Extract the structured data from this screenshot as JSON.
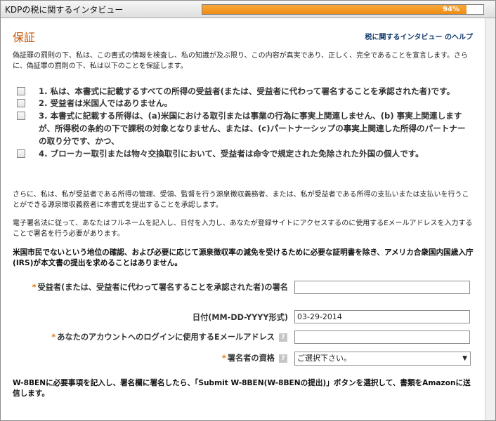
{
  "window": {
    "title": "KDPの税に関するインタビュー",
    "progress": {
      "value": 94,
      "label": "94%"
    }
  },
  "page": {
    "heading": "保証",
    "help_link": "税に関するインタビュー のヘルプ",
    "intro": "偽証罪の罰則の下、私は、この書式の情報を検査し、私の知識が及ぶ限り、この内容が真実であり、正しく、完全であることを宣言します。さらに、偽証罪の罰則の下、私は以下のことを保証します。",
    "checkboxes": [
      {
        "number": "1.",
        "text": "私は、本書式に記載するすべての所得の受益者(または、受益者に代わって署名することを承認された者)です。"
      },
      {
        "number": "2.",
        "text": "受益者は米国人ではありません。"
      },
      {
        "number": "3.",
        "text": "本書式に記載する所得は、(a)米国における取引または事業の行為に事実上関連しません、(b) 事実上関連しますが、所得税の条約の下で課税の対象となりません、または、(c)パートナーシップの事実上関連した所得のパートナーの取り分です、かつ、"
      },
      {
        "number": "4.",
        "text": "ブローカー取引または物々交換取引において、受益者は命令で規定された免除された外国の個人です。"
      }
    ],
    "para_withholding": "さらに、私は、私が受益者である所得の管理、受領、監督を行う源泉徴収義務者、または、私が受益者である所得の支払いまたは支払いを行うことができる源泉徴収義務者に本書式を提出することを承認します。",
    "para_signature": "電子署名法に従って、あなたはフルネームを記入し、日付を入力し、あなたが登録サイトにアクセスするのに使用するEメールアドレスを入力することで署名を行う必要があります。",
    "bold_notice": "米国市民でないという地位の確認、および必要に応じて源泉徴収率の減免を受けるために必要な証明書を除き、アメリカ合衆国内国歳入庁(IRS)が本文書の提出を求めることはありません。",
    "form": {
      "signature_label": "受益者(または、受益者に代わって署名することを承認された者)の署名",
      "signature_value": "",
      "date_label": "日付(MM-DD-YYYY形式)",
      "date_value": "03-29-2014",
      "email_label": "あなたのアカウントへのログインに使用するEメールアドレス",
      "email_value": "",
      "capacity_label": "署名者の資格",
      "capacity_value": "ご選択下さい。"
    },
    "final_note": "W-8BENに必要事項を記入し、署名欄に署名したら、「Submit W-8BEN(W-8BENの提出)」ボタンを選択して、書類をAmazonに送信します。"
  },
  "colors": {
    "accent": "#c45500",
    "progress": "#ef8c12",
    "link": "#123a6c"
  }
}
